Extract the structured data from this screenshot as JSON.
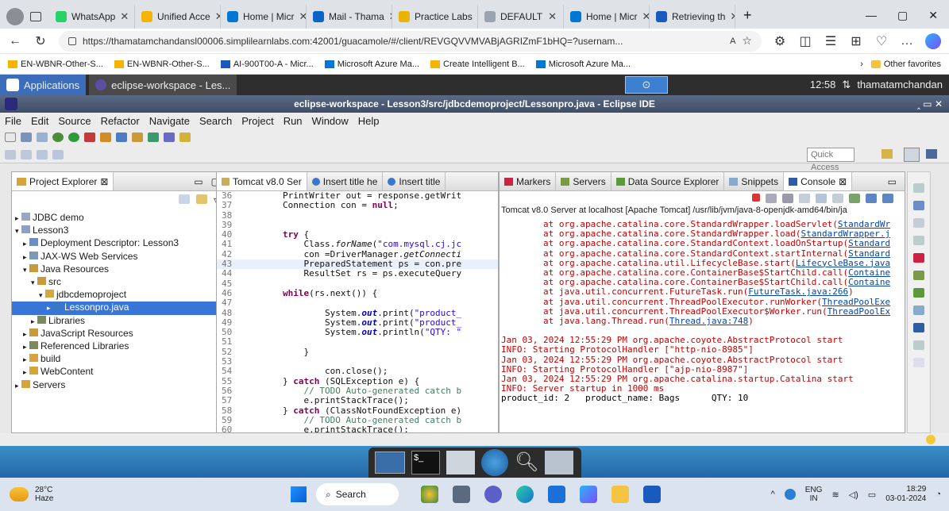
{
  "browser": {
    "tabs": [
      {
        "label": "WhatsApp",
        "color": "#25d366"
      },
      {
        "label": "Unified Acce",
        "color": "#f4b400"
      },
      {
        "label": "Home | Micr",
        "color": "#0078d4"
      },
      {
        "label": "Mail - Thama",
        "color": "#0a64c8"
      },
      {
        "label": "Practice Labs",
        "color": "#e8b400"
      },
      {
        "label": "DEFAULT",
        "color": "#9aa4b0"
      },
      {
        "label": "Home | Micr",
        "color": "#0078d4"
      },
      {
        "label": "Retrieving th",
        "color": "#185abd"
      }
    ],
    "new_tab": "+",
    "url": "https://thamatamchandansl00006.simplilearnlabs.com:42001/guacamole/#/client/REVGQVVMVABjAGRIZmF1bHQ=?usernam...",
    "favorites": [
      "EN-WBNR-Other-S...",
      "EN-WBNR-Other-S...",
      "AI-900T00-A - Micr...",
      "Microsoft Azure Ma...",
      "Create Intelligent B...",
      "Microsoft Azure Ma..."
    ],
    "other_favorites": "Other favorites"
  },
  "gnome": {
    "applications": "Applications",
    "window": "eclipse-workspace - Les...",
    "clock": "12:58",
    "user": "thamatamchandan"
  },
  "eclipse": {
    "title": "eclipse-workspace - Lesson3/src/jdbcdemoproject/Lessonpro.java - Eclipse IDE",
    "menu": [
      "File",
      "Edit",
      "Source",
      "Refactor",
      "Navigate",
      "Search",
      "Project",
      "Run",
      "Window",
      "Help"
    ],
    "quick_access": "Quick Access",
    "explorer": {
      "tab": "Project Explorer",
      "items": [
        {
          "label": "JDBC demo",
          "indent": 0
        },
        {
          "label": "Lesson3",
          "indent": 0
        },
        {
          "label": "Deployment Descriptor: Lesson3",
          "indent": 1
        },
        {
          "label": "JAX-WS Web Services",
          "indent": 1
        },
        {
          "label": "Java Resources",
          "indent": 1
        },
        {
          "label": "src",
          "indent": 2
        },
        {
          "label": "jdbcdemoproject",
          "indent": 3
        },
        {
          "label": "Lessonpro.java",
          "indent": 4
        },
        {
          "label": "Libraries",
          "indent": 2
        },
        {
          "label": "JavaScript Resources",
          "indent": 1
        },
        {
          "label": "Referenced Libraries",
          "indent": 1
        },
        {
          "label": "build",
          "indent": 1
        },
        {
          "label": "WebContent",
          "indent": 1
        },
        {
          "label": "Servers",
          "indent": 0
        }
      ]
    },
    "editor_tabs": [
      "Tomcat v8.0 Ser",
      "Insert title he",
      "Insert title"
    ],
    "code": [
      {
        "n": "36",
        "t": "        PrintWriter out = response.getWrit"
      },
      {
        "n": "37",
        "t": "        Connection con = null;"
      },
      {
        "n": "38",
        "t": ""
      },
      {
        "n": "39",
        "t": ""
      },
      {
        "n": "40",
        "t": "        try {"
      },
      {
        "n": "41",
        "t": "            Class.forName(\"com.mysql.cj.jc"
      },
      {
        "n": "42",
        "t": "            con =DriverManager.getConnecti"
      },
      {
        "n": "43",
        "t": "            PreparedStatement ps = con.pre"
      },
      {
        "n": "44",
        "t": "            ResultSet rs = ps.executeQuery"
      },
      {
        "n": "45",
        "t": ""
      },
      {
        "n": "46",
        "t": "        while(rs.next()) {"
      },
      {
        "n": "47",
        "t": ""
      },
      {
        "n": "48",
        "t": "                System.out.print(\"product_"
      },
      {
        "n": "49",
        "t": "                System.out.print(\"product_"
      },
      {
        "n": "50",
        "t": "                System.out.println(\"QTY: \""
      },
      {
        "n": "51",
        "t": ""
      },
      {
        "n": "52",
        "t": "            }"
      },
      {
        "n": "53",
        "t": ""
      },
      {
        "n": "54",
        "t": "                con.close();"
      },
      {
        "n": "55",
        "t": "        } catch (SQLException e) {"
      },
      {
        "n": "56",
        "t": "            // TODO Auto-generated catch b"
      },
      {
        "n": "57",
        "t": "            e.printStackTrace();"
      },
      {
        "n": "58",
        "t": "        } catch (ClassNotFoundException e)"
      },
      {
        "n": "59",
        "t": "            // TODO Auto-generated catch b"
      },
      {
        "n": "60",
        "t": "            e.printStackTrace();"
      }
    ],
    "bottom_tabs": [
      "Markers",
      "Servers",
      "Data Source Explorer",
      "Snippets",
      "Console"
    ],
    "console_header": "Tomcat v8.0 Server at localhost [Apache Tomcat] /usr/lib/jvm/java-8-openjdk-amd64/bin/ja",
    "stack": [
      {
        "pre": "        at org.apache.catalina.core.StandardWrapper.loadServlet(",
        "link": "StandardWr"
      },
      {
        "pre": "        at org.apache.catalina.core.StandardWrapper.load(",
        "link": "StandardWrapper.j"
      },
      {
        "pre": "        at org.apache.catalina.core.StandardContext.loadOnStartup(",
        "link": "Standard"
      },
      {
        "pre": "        at org.apache.catalina.core.StandardContext.startInternal(",
        "link": "Standard"
      },
      {
        "pre": "        at org.apache.catalina.util.LifecycleBase.start(",
        "link": "LifecycleBase.java"
      },
      {
        "pre": "        at org.apache.catalina.core.ContainerBase$StartChild.call(",
        "link": "Containe"
      },
      {
        "pre": "        at org.apache.catalina.core.ContainerBase$StartChild.call(",
        "link": "Containe"
      },
      {
        "pre": "        at java.util.concurrent.FutureTask.run(",
        "link": "FutureTask.java:266",
        "post": ")"
      },
      {
        "pre": "        at java.util.concurrent.ThreadPoolExecutor.runWorker(",
        "link": "ThreadPoolExe"
      },
      {
        "pre": "        at java.util.concurrent.ThreadPoolExecutor$Worker.run(",
        "link": "ThreadPoolEx"
      },
      {
        "pre": "        at java.lang.Thread.run(",
        "link": "Thread.java:748",
        "post": ")"
      }
    ],
    "log": [
      "Jan 03, 2024 12:55:29 PM org.apache.coyote.AbstractProtocol start",
      "INFO: Starting ProtocolHandler [\"http-nio-8985\"]",
      "Jan 03, 2024 12:55:29 PM org.apache.coyote.AbstractProtocol start",
      "INFO: Starting ProtocolHandler [\"ajp-nio-8987\"]",
      "Jan 03, 2024 12:55:29 PM org.apache.catalina.startup.Catalina start",
      "INFO: Server startup in 1000 ms"
    ],
    "output": "product_id: 2   product_name: Bags      QTY: 10"
  },
  "taskbar": {
    "weather_temp": "28°C",
    "weather_desc": "Haze",
    "search": "Search",
    "lang": "ENG",
    "region": "IN",
    "time": "18:29",
    "date": "03-01-2024"
  }
}
